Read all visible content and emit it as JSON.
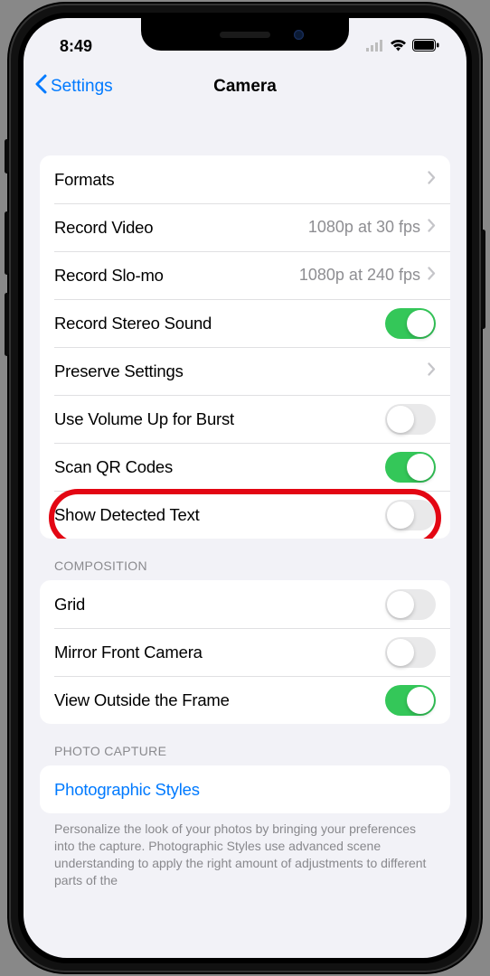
{
  "status": {
    "time": "8:49"
  },
  "nav": {
    "back": "Settings",
    "title": "Camera"
  },
  "section1": {
    "items": [
      {
        "label": "Formats",
        "type": "chevron"
      },
      {
        "label": "Record Video",
        "value": "1080p at 30 fps",
        "type": "chevron"
      },
      {
        "label": "Record Slo-mo",
        "value": "1080p at 240 fps",
        "type": "chevron"
      },
      {
        "label": "Record Stereo Sound",
        "type": "toggle",
        "on": true
      },
      {
        "label": "Preserve Settings",
        "type": "chevron"
      },
      {
        "label": "Use Volume Up for Burst",
        "type": "toggle",
        "on": false
      },
      {
        "label": "Scan QR Codes",
        "type": "toggle",
        "on": true
      },
      {
        "label": "Show Detected Text",
        "type": "toggle",
        "on": false,
        "highlighted": true
      }
    ]
  },
  "section2": {
    "header": "COMPOSITION",
    "items": [
      {
        "label": "Grid",
        "type": "toggle",
        "on": false
      },
      {
        "label": "Mirror Front Camera",
        "type": "toggle",
        "on": false
      },
      {
        "label": "View Outside the Frame",
        "type": "toggle",
        "on": true
      }
    ]
  },
  "section3": {
    "header": "PHOTO CAPTURE",
    "items": [
      {
        "label": "Photographic Styles",
        "type": "link"
      }
    ],
    "footer": "Personalize the look of your photos by bringing your preferences into the capture. Photographic Styles use advanced scene understanding to apply the right amount of adjustments to different parts of the"
  }
}
